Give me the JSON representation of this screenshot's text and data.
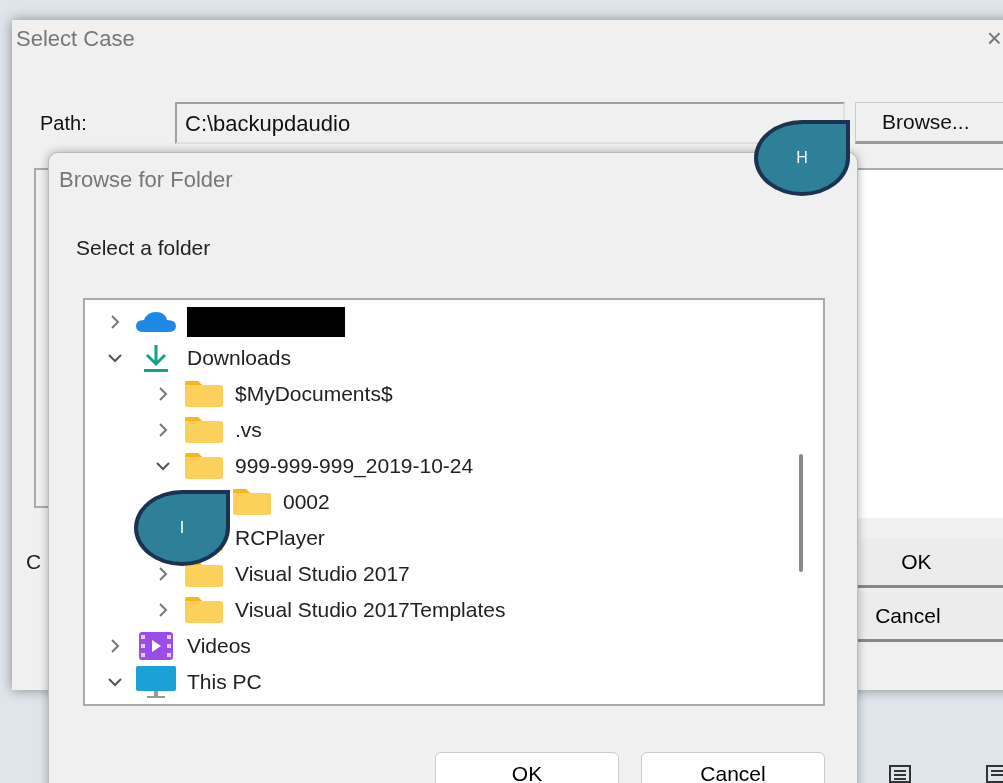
{
  "main_window": {
    "title": "Select Case",
    "close": "×",
    "path_label": "Path:",
    "path_value": "C:\\backupdaudio",
    "browse_button": "Browse...",
    "partial_label": "C",
    "ok_button": "OK",
    "cancel_button": "Cancel"
  },
  "browse_dialog": {
    "title": "Browse for Folder",
    "prompt": "Select a folder",
    "tree": [
      {
        "kind": "cloud",
        "redacted": true,
        "expanded": false
      },
      {
        "kind": "downloads",
        "label": "Downloads",
        "expanded": true,
        "children": [
          {
            "kind": "folder",
            "label": "$MyDocuments$",
            "expanded": false
          },
          {
            "kind": "folder",
            "label": ".vs",
            "expanded": false
          },
          {
            "kind": "folder",
            "label": "999-999-999_2019-10-24",
            "expanded": true,
            "children": [
              {
                "kind": "folder",
                "label": "0002"
              }
            ]
          },
          {
            "kind": "folder",
            "label": "RCPlayer"
          },
          {
            "kind": "folder",
            "label": "Visual Studio 2017",
            "expanded": false
          },
          {
            "kind": "folder",
            "label": "Visual Studio 2017Templates",
            "expanded": false
          }
        ]
      },
      {
        "kind": "videos",
        "label": "Videos",
        "expanded": false
      },
      {
        "kind": "pc",
        "label": "This PC",
        "expanded": true
      }
    ],
    "ok_button": "OK",
    "cancel_button": "Cancel"
  },
  "callouts": [
    {
      "label": "H"
    },
    {
      "label": "I"
    }
  ]
}
